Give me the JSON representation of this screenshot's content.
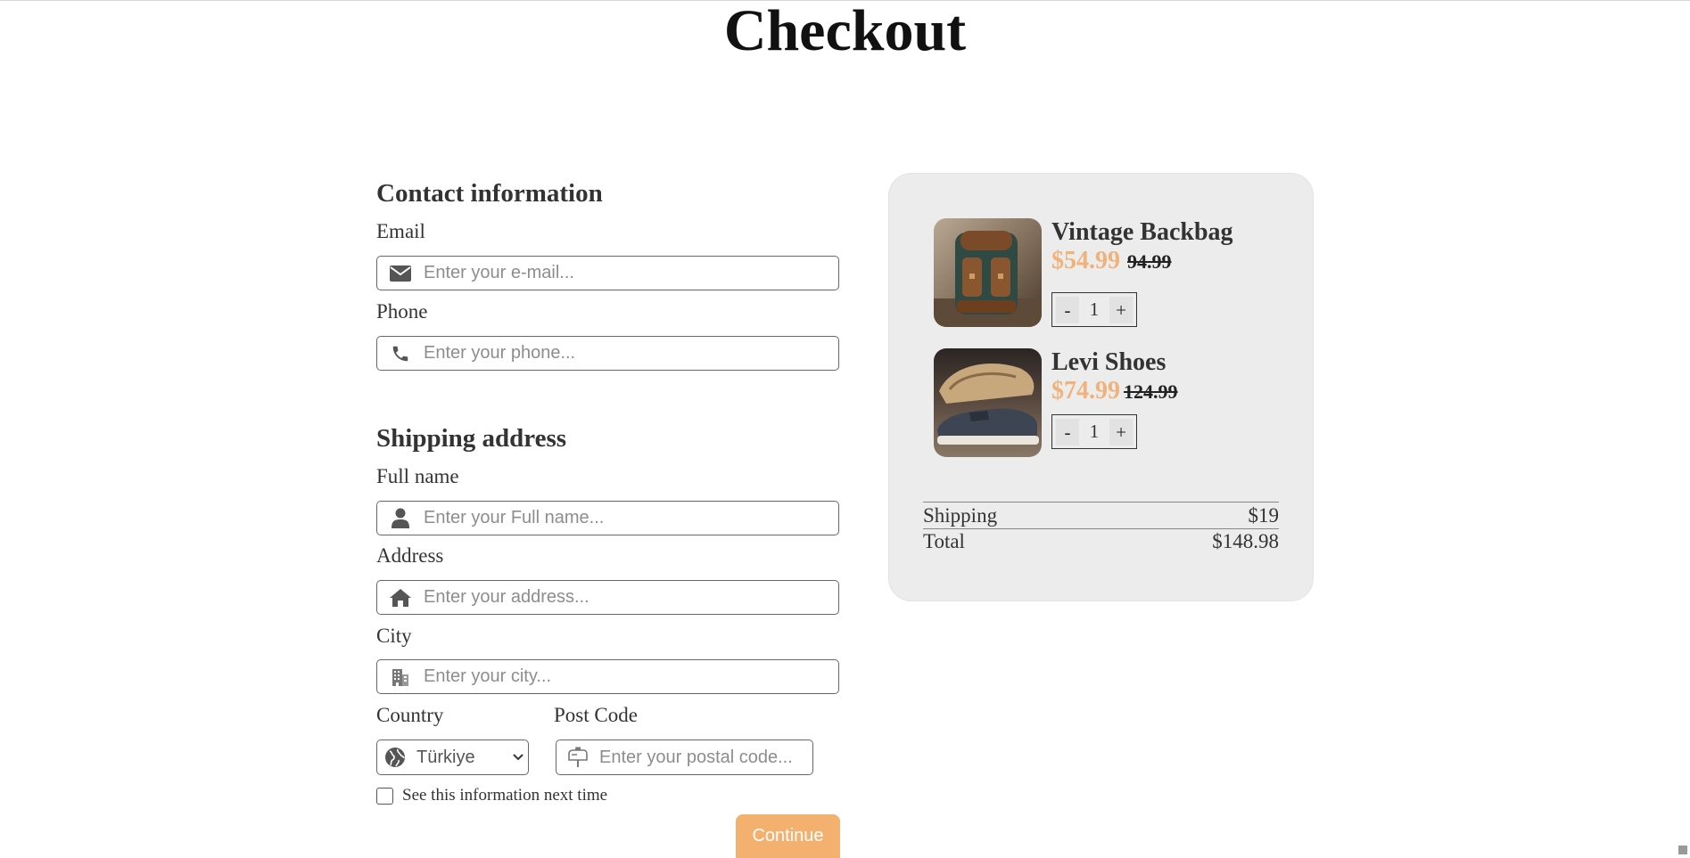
{
  "page": {
    "title": "Checkout"
  },
  "contact": {
    "title": "Contact information",
    "email_label": "Email",
    "email_placeholder": "Enter your e-mail...",
    "email_value": "",
    "phone_label": "Phone",
    "phone_placeholder": "Enter your phone...",
    "phone_value": ""
  },
  "shipping": {
    "title": "Shipping address",
    "fullname_label": "Full name",
    "fullname_placeholder": "Enter your Full name...",
    "address_label": "Address",
    "address_placeholder": "Enter your address...",
    "city_label": "City",
    "city_placeholder": "Enter your city...",
    "country_label": "Country",
    "country_selected": "Türkiye",
    "postcode_label": "Post Code",
    "postcode_placeholder": "Enter your postal code...",
    "remember_label": "See this information next time",
    "remember_checked": false,
    "continue_label": "Continue"
  },
  "cart": {
    "items": [
      {
        "name": "Vintage Backbag",
        "price": "$54.99",
        "old_price": "94.99",
        "qty": "1",
        "minus": "-",
        "plus": "+",
        "image": "backpack-photo"
      },
      {
        "name": "Levi Shoes",
        "price": "$74.99",
        "old_price": "124.99",
        "qty": "1",
        "minus": "-",
        "plus": "+",
        "image": "shoes-photo"
      }
    ],
    "shipping_label": "Shipping",
    "shipping_value": "$19",
    "total_label": "Total",
    "total_value": "$148.98"
  },
  "colors": {
    "accent": "#f4b06e",
    "price": "#f0b27a",
    "cart_bg": "#ececec",
    "text": "#333333"
  },
  "icons": {
    "email": "envelope-icon",
    "phone": "phone-icon",
    "fullname": "user-icon",
    "address": "home-icon",
    "city": "building-icon",
    "country": "globe-icon",
    "postcode": "mailbox-icon",
    "select": "chevron-down-icon"
  }
}
